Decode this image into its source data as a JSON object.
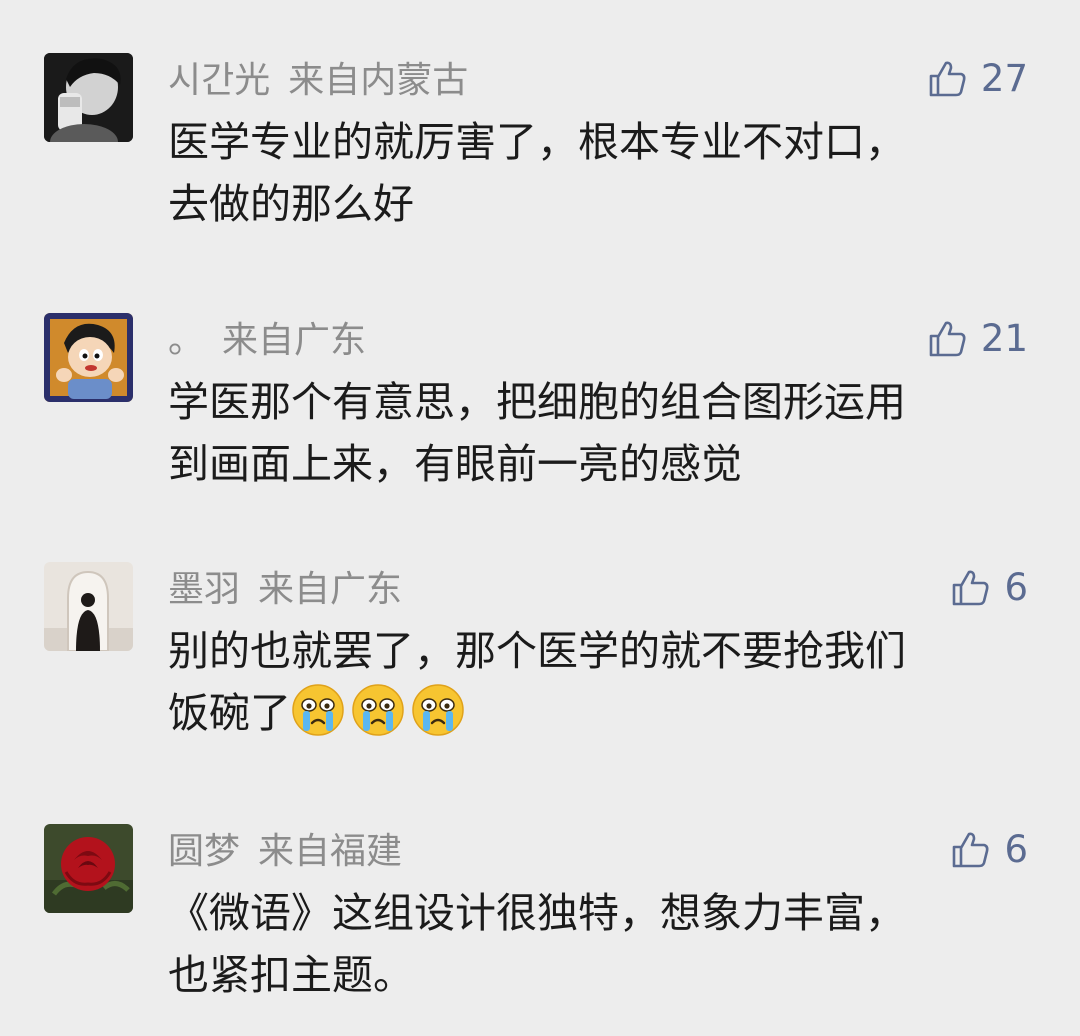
{
  "colors": {
    "background": "#ededed",
    "meta_text": "#8c8c8c",
    "like_accent": "#5b6b91",
    "body_text": "#1b1b1b"
  },
  "like_icon": "thumbs-up-icon",
  "comments": [
    {
      "avatar": "avatar-photo-boy-drinking",
      "name": "시간光",
      "location": "来自内蒙古",
      "likes": "27",
      "lines": [
        "医学专业的就厉害了，根本专业不对口，",
        "去做的那么好"
      ]
    },
    {
      "avatar": "avatar-cartoon-child",
      "name": "。",
      "location": "来自广东",
      "likes": "21",
      "lines": [
        "学医那个有意思，把细胞的组合图形运用",
        "到画面上来，有眼前一亮的感觉"
      ]
    },
    {
      "avatar": "avatar-silhouette-window",
      "name": "墨羽",
      "location": "来自广东",
      "likes": "6",
      "lines": [
        "别的也就罢了，那个医学的就不要抢我们",
        "饭碗了"
      ],
      "emoji": [
        "crying-face-emoji",
        "crying-face-emoji",
        "crying-face-emoji"
      ]
    },
    {
      "avatar": "avatar-red-rose",
      "name": "圆梦",
      "location": "来自福建",
      "likes": "6",
      "lines": [
        "《微语》这组设计很独特，想象力丰富，",
        "也紧扣主题。"
      ]
    }
  ]
}
